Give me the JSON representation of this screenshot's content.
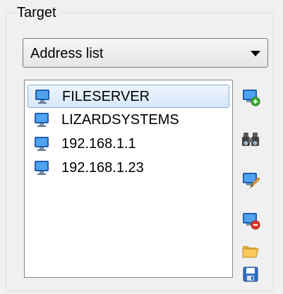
{
  "group": {
    "title": "Target"
  },
  "combo": {
    "selected": "Address list"
  },
  "list": {
    "items": [
      {
        "label": "FILESERVER",
        "selected": true
      },
      {
        "label": "LIZARDSYSTEMS",
        "selected": false
      },
      {
        "label": "192.168.1.1",
        "selected": false
      },
      {
        "label": "192.168.1.23",
        "selected": false
      }
    ]
  },
  "toolbar": {
    "buttons": [
      {
        "icon": "add-computer-icon"
      },
      {
        "icon": "binoculars-icon"
      },
      {
        "icon": "edit-computer-icon"
      },
      {
        "icon": "remove-computer-icon"
      },
      {
        "icon": "open-folder-icon"
      },
      {
        "icon": "save-disk-icon"
      }
    ]
  },
  "colors": {
    "selection_border": "#84acdd",
    "selection_fill": "#d6e7fb",
    "monitor_blue": "#3b86d6"
  }
}
